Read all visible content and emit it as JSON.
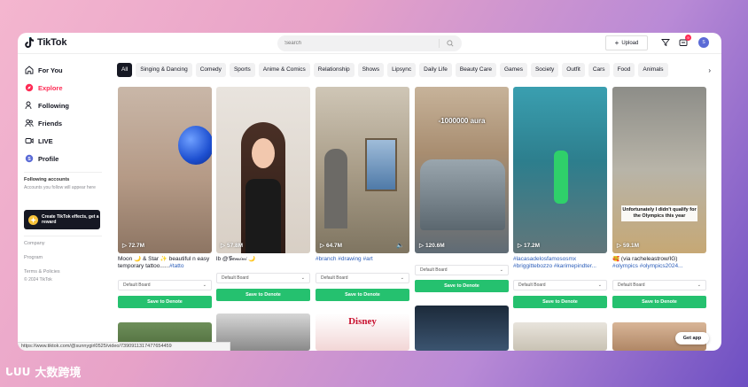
{
  "header": {
    "logo_text": "TikTok",
    "search_placeholder": "Search",
    "upload_label": "Upload",
    "inbox_badge": "9",
    "avatar_letter": "S"
  },
  "sidebar": {
    "nav": [
      {
        "label": "For You",
        "icon": "home-icon"
      },
      {
        "label": "Explore",
        "icon": "compass-icon"
      },
      {
        "label": "Following",
        "icon": "following-icon"
      },
      {
        "label": "Friends",
        "icon": "friends-icon"
      },
      {
        "label": "LIVE",
        "icon": "live-icon"
      },
      {
        "label": "Profile",
        "icon": "profile-icon"
      }
    ],
    "following_heading": "Following accounts",
    "following_sub": "Accounts you follow will appear here",
    "effects_label": "Create TikTok effects, get a reward",
    "links": [
      "Company",
      "Program",
      "Terms & Policies"
    ],
    "copyright": "© 2024 TikTok"
  },
  "categories": [
    "All",
    "Singing & Dancing",
    "Comedy",
    "Sports",
    "Anime & Comics",
    "Relationship",
    "Shows",
    "Lipsync",
    "Daily Life",
    "Beauty Care",
    "Games",
    "Society",
    "Outfit",
    "Cars",
    "Food",
    "Animals"
  ],
  "cards": [
    {
      "views": "72.7M",
      "caption_text": "Moon 🌙 & Star ✨ beautiful n easy temporary tattoo......",
      "caption_tags": "#tatto",
      "board": "Default Board",
      "save": "Save to Denote"
    },
    {
      "views": "57.8M",
      "caption_text": "lb @𝒢𝑒𝓂𝒾𝓃𝒾 🌙",
      "caption_tags": "",
      "board": "Default Board",
      "save": "Save to Denote"
    },
    {
      "views": "64.7M",
      "caption_text": "",
      "caption_tags": "#branch #drawing #art",
      "board": "Default Board",
      "save": "Save to Denote"
    },
    {
      "views": "120.6M",
      "caption_text": "",
      "caption_tags": "",
      "board": "Default Board",
      "save": "Save to Denote",
      "overlay": "-1000000 aura"
    },
    {
      "views": "17.2M",
      "caption_text": "",
      "caption_tags": "#lacasadelosfamososmx #briggittebozzo #karimepindter...",
      "board": "Default Board",
      "save": "Save to Denote"
    },
    {
      "views": "59.1M",
      "caption_text": "🥰 (via racheleastrow/IG)",
      "caption_tags": "#olympics #olympics2024...",
      "board": "Default Board",
      "save": "Save to Denote",
      "overlay": "Unfortunately I didn't qualify for the Olympics this year"
    }
  ],
  "row2_overlay": "Disney",
  "status_url": "https://www.tiktok.com/@sunnygirl0525/video/7390911317477654459",
  "get_app": "Get app",
  "watermark": "大数跨境",
  "colors": {
    "brand_red": "#fe2c55",
    "save_green": "#25c16f",
    "tag_blue": "#2b5db9"
  }
}
